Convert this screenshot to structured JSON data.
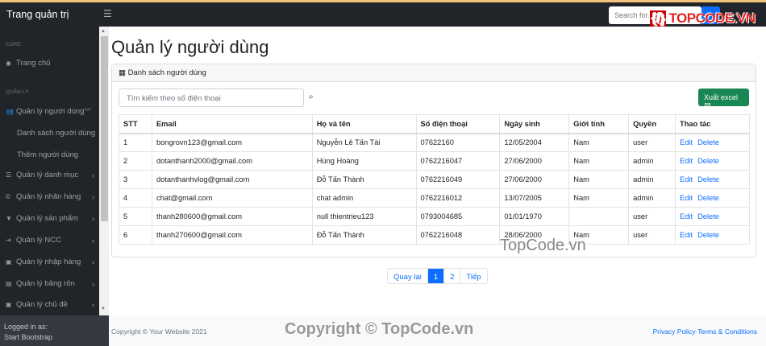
{
  "topbar": {
    "brand": "Trang quản trị",
    "search_placeholder": "Search for...",
    "watermark_logo": "TOPCODE.VN"
  },
  "sidebar": {
    "sections": [
      {
        "heading": "CORE"
      },
      {
        "heading": "QUẢN LÝ"
      }
    ],
    "items": [
      {
        "label": "Trang chủ",
        "icon": "dashboard-icon"
      },
      {
        "label": "Quản lý người dùng",
        "icon": "users-icon"
      },
      {
        "label": "Quản lý danh mục",
        "icon": "list-icon"
      },
      {
        "label": "Quản lý nhãn hàng",
        "icon": "copyright-icon"
      },
      {
        "label": "Quản lý sản phẩm",
        "icon": "shirt-icon"
      },
      {
        "label": "Quản lý NCC",
        "icon": "truck-icon"
      },
      {
        "label": "Quản lý nhập hàng",
        "icon": "import-icon"
      },
      {
        "label": "Quản lý băng rôn",
        "icon": "banner-icon"
      },
      {
        "label": "Quản lý chủ đề",
        "icon": "topic-icon"
      }
    ],
    "subitems": [
      {
        "label": "Danh sách người dùng"
      },
      {
        "label": "Thêm người dùng"
      }
    ],
    "footer": {
      "line1": "Logged in as:",
      "line2": "Start Bootstrap"
    }
  },
  "main": {
    "title": "Quản lý người dùng",
    "card_header": "Danh sách người dùng",
    "search_placeholder": "Tìm kiếm theo số điện thoại",
    "export_label": "Xuất excel",
    "columns": [
      "STT",
      "Email",
      "Họ và tên",
      "Số điện thoại",
      "Ngày sinh",
      "Giới tính",
      "Quyền",
      "Thao tác"
    ],
    "rows": [
      [
        "1",
        "bongrovn123@gmail.com",
        "Nguyễn Lê Tấn Tài",
        "07622160",
        "12/05/2004",
        "Nam",
        "user"
      ],
      [
        "2",
        "dotanthanh2000@gmail.com",
        "Hùng Hoàng",
        "0762216047",
        "27/06/2000",
        "Nam",
        "admin"
      ],
      [
        "3",
        "dotanthanhvlog@gmail.com",
        "Đỗ Tấn Thành",
        "0762216049",
        "27/06/2000",
        "Nam",
        "admin"
      ],
      [
        "4",
        "chat@gmail.com",
        "chat admin",
        "0762216012",
        "13/07/2005",
        "Nam",
        "admin"
      ],
      [
        "5",
        "thanh280600@gmail.com",
        "null thientrieu123",
        "0793004685",
        "01/01/1970",
        "",
        "user"
      ],
      [
        "6",
        "thanh270600@gmail.com",
        "Đỗ Tấn Thành",
        "0762216048",
        "28/06/2000",
        "Nam",
        "user"
      ]
    ],
    "edit_label": "Edit",
    "delete_label": "Delete",
    "pagination": {
      "prev": "Quay lại",
      "pages": [
        "1",
        "2"
      ],
      "current": "1",
      "next": "Tiếp"
    }
  },
  "footer": {
    "copyright": "Copyright © Your Website 2021",
    "links": "Privacy Policy·Terms & Conditions"
  },
  "watermarks": {
    "mid": "TopCode.vn",
    "bottom": "Copyright © TopCode.vn"
  },
  "colors": {
    "primary": "#0d6efd",
    "success": "#198754",
    "dark": "#212529"
  }
}
